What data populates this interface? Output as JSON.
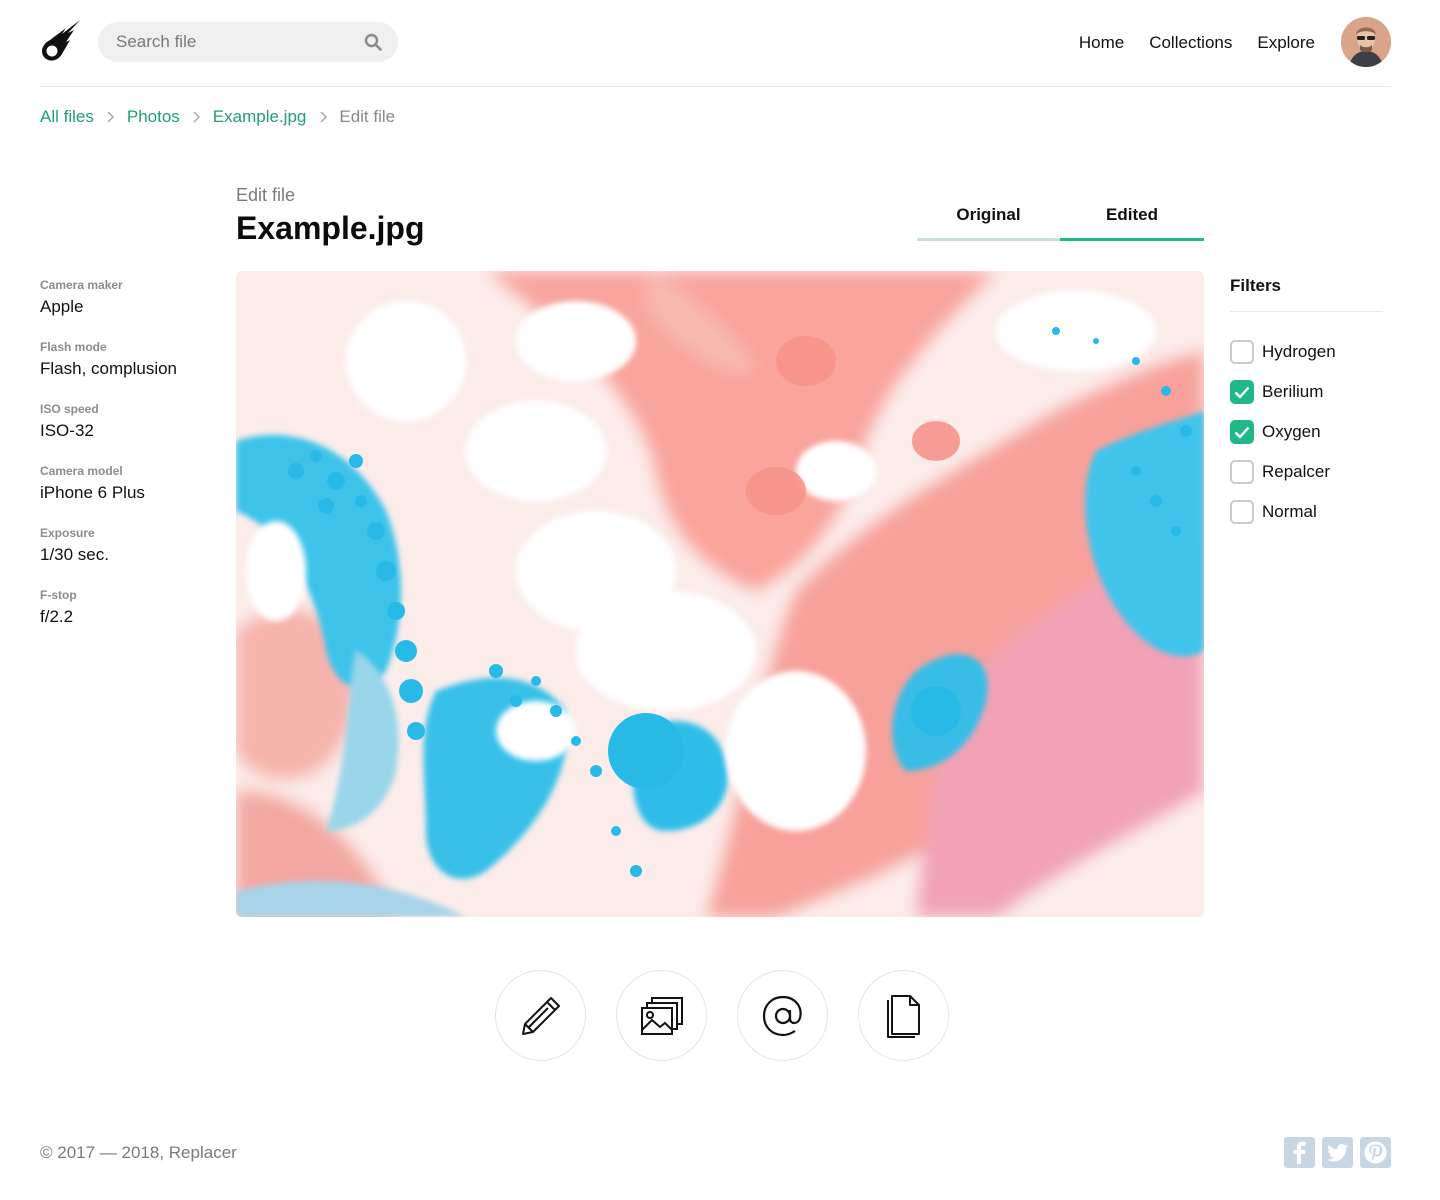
{
  "header": {
    "logo_icon": "comet-logo-icon",
    "search": {
      "placeholder": "Search file",
      "value": ""
    },
    "nav": [
      "Home",
      "Collections",
      "Explore"
    ],
    "avatar_icon": "user-avatar"
  },
  "breadcrumb": {
    "items": [
      "All files",
      "Photos",
      "Example.jpg"
    ],
    "current": "Edit file",
    "link_color": "#1f9e77"
  },
  "page": {
    "kicker": "Edit file",
    "title": "Example.jpg"
  },
  "tabs": {
    "items": [
      "Original",
      "Edited"
    ],
    "active": "Edited",
    "active_color": "#1fb88a",
    "inactive_color": "#c8dde0"
  },
  "meta": [
    {
      "label": "Camera maker",
      "value": "Apple"
    },
    {
      "label": "Flash mode",
      "value": "Flash, complusion"
    },
    {
      "label": "ISO speed",
      "value": "ISO-32"
    },
    {
      "label": "Camera model",
      "value": "iPhone 6 Plus"
    },
    {
      "label": "Exposure",
      "value": "1/30 sec."
    },
    {
      "label": "F-stop",
      "value": "f/2.2"
    }
  ],
  "filters": {
    "title": "Filters",
    "items": [
      {
        "label": "Hydrogen",
        "checked": false
      },
      {
        "label": "Berilium",
        "checked": true
      },
      {
        "label": "Oxygen",
        "checked": true
      },
      {
        "label": "Repalcer",
        "checked": false
      },
      {
        "label": "Normal",
        "checked": false
      }
    ]
  },
  "actions": [
    "pencil-icon",
    "gallery-icon",
    "at-sign-icon",
    "document-icon"
  ],
  "footer": {
    "copyright": "© 2017 — 2018, Replacer",
    "social": [
      "facebook-icon",
      "twitter-icon",
      "pinterest-icon"
    ]
  }
}
